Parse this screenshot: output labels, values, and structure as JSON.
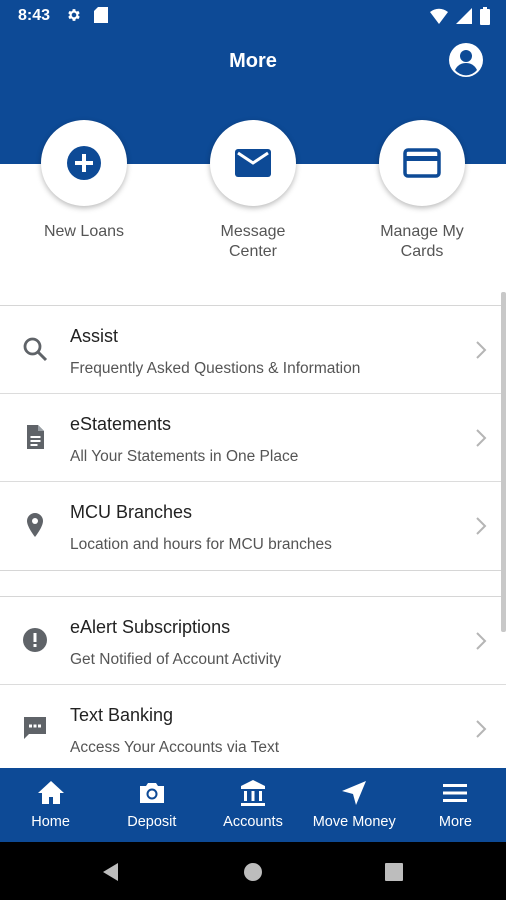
{
  "status_bar": {
    "time": "8:43",
    "left_icons": [
      "gear-icon",
      "sd-card-icon"
    ],
    "right_icons": [
      "wifi-icon",
      "signal-icon",
      "battery-icon"
    ]
  },
  "header": {
    "title": "More",
    "profile_icon": "account-circle-icon"
  },
  "quick_actions": [
    {
      "label": "New Loans",
      "icon": "add-circle-icon"
    },
    {
      "label": "Message\nCenter",
      "icon": "mail-icon"
    },
    {
      "label": "Manage My\nCards",
      "icon": "credit-card-icon"
    }
  ],
  "list_section_1": [
    {
      "title": "Assist",
      "subtitle": "Frequently Asked Questions & Information",
      "icon": "search-icon"
    },
    {
      "title": "eStatements",
      "subtitle": "All Your Statements in One Place",
      "icon": "document-icon"
    },
    {
      "title": "MCU Branches",
      "subtitle": "Location and hours for MCU branches",
      "icon": "location-pin-icon"
    }
  ],
  "list_section_2": [
    {
      "title": "eAlert Subscriptions",
      "subtitle": "Get Notified of Account Activity",
      "icon": "alert-circle-icon"
    },
    {
      "title": "Text Banking",
      "subtitle": "Access Your Accounts via Text",
      "icon": "chat-icon"
    }
  ],
  "bottom_nav": [
    {
      "label": "Home",
      "icon": "home-icon"
    },
    {
      "label": "Deposit",
      "icon": "camera-icon"
    },
    {
      "label": "Accounts",
      "icon": "bank-icon"
    },
    {
      "label": "Move Money",
      "icon": "navigation-arrow-icon"
    },
    {
      "label": "More",
      "icon": "menu-icon",
      "active": true
    }
  ],
  "colors": {
    "brand_blue": "#0d4a96",
    "icon_gray": "#5f6368",
    "text_dark": "#222222",
    "text_muted": "#555555"
  }
}
